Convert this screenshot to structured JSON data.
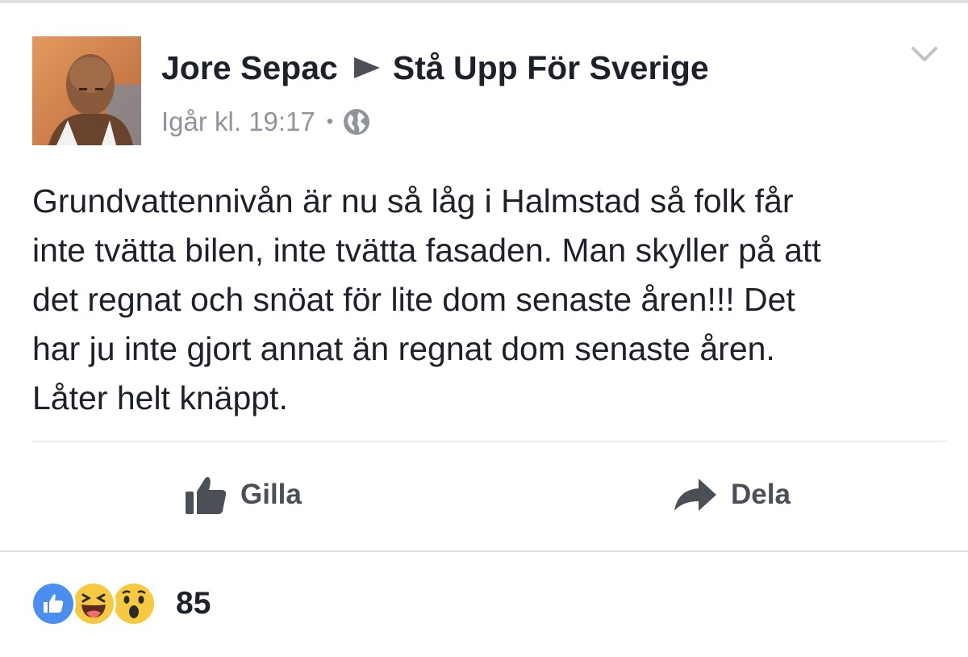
{
  "post": {
    "author": "Jore Sepac",
    "group": "Stå Upp För Sverige",
    "timestamp": "Igår kl. 19:17",
    "separator": "•",
    "privacy_icon": "globe-icon",
    "menu_icon": "chevron-down-icon",
    "text_lines": [
      "Grundvattennivån är nu så låg i Halmstad så folk får",
      "inte tvätta bilen, inte tvätta fasaden. Man skyller på att",
      "det regnat och snöat för lite dom senaste åren!!! Det",
      "har ju inte gjort annat än regnat dom senaste åren.",
      "Låter helt knäppt."
    ]
  },
  "actions": {
    "like_label": "Gilla",
    "share_label": "Dela"
  },
  "reactions": {
    "icons": [
      "like-icon",
      "haha-icon",
      "wow-icon"
    ],
    "count": "85"
  },
  "colors": {
    "text": "#1d2129",
    "meta": "#90949c",
    "action": "#4b4f56",
    "like_blue": "#4a8ff0",
    "emoji_yellow": "#f7c940"
  }
}
